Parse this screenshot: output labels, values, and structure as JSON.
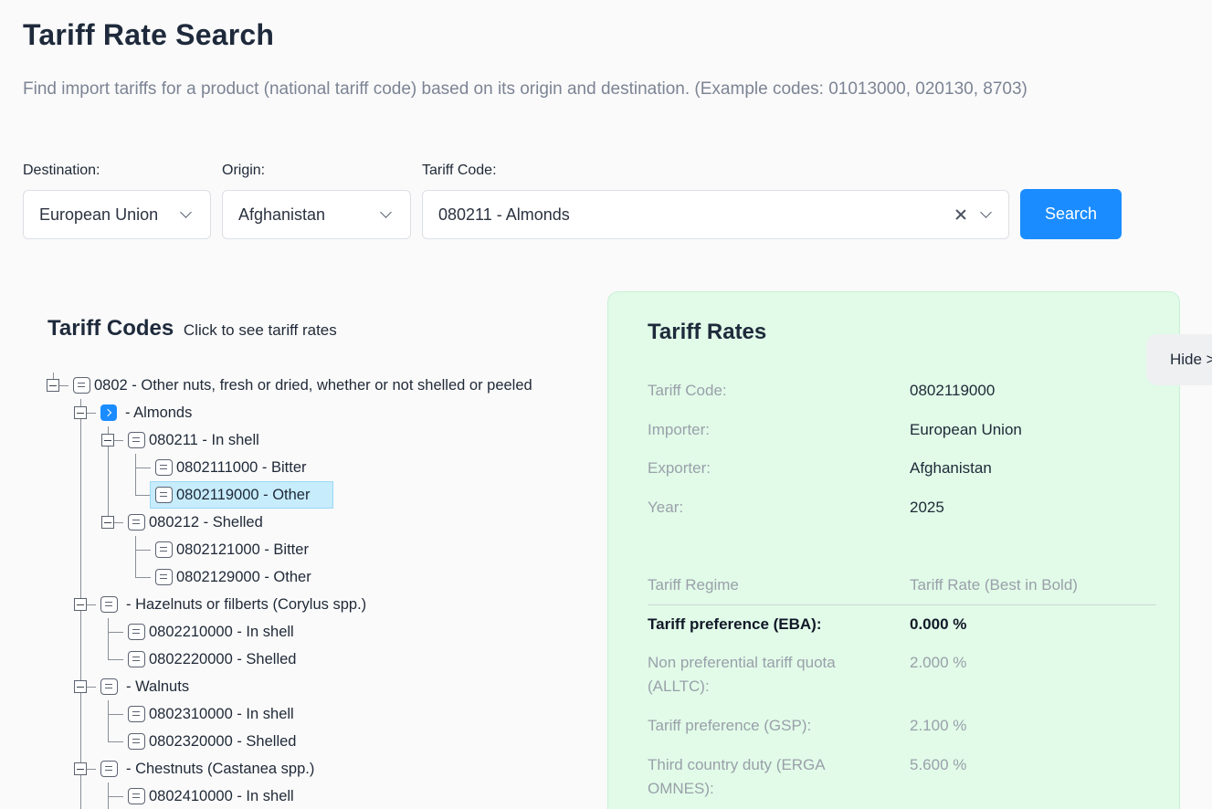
{
  "page": {
    "title": "Tariff Rate Search",
    "subtitle": "Find import tariffs for a product (national tariff code) based on its origin and destination. (Example codes: 01013000, 020130, 8703)"
  },
  "form": {
    "destination_label": "Destination:",
    "destination_value": "European Union",
    "origin_label": "Origin:",
    "origin_value": "Afghanistan",
    "code_label": "Tariff Code:",
    "code_value": "080211 - Almonds",
    "search_label": "Search"
  },
  "codes": {
    "title": "Tariff Codes",
    "hint": "Click to see tariff rates",
    "items": [
      "0802 - Other nuts, fresh or dried, whether or not shelled or peeled",
      "- Almonds",
      "080211 - In shell",
      "0802111000 - Bitter",
      "0802119000 - Other",
      "080212 - Shelled",
      "0802121000 - Bitter",
      "0802129000 - Other",
      "- Hazelnuts or filberts (Corylus spp.)",
      "0802210000 - In shell",
      "0802220000 - Shelled",
      "- Walnuts",
      "0802310000 - In shell",
      "0802320000 - Shelled",
      "- Chestnuts (Castanea spp.)",
      "0802410000 - In shell"
    ]
  },
  "rates": {
    "title": "Tariff Rates",
    "hide_label": "Hide >",
    "info": [
      {
        "label": "Tariff Code:",
        "value": "0802119000"
      },
      {
        "label": "Importer:",
        "value": "European Union"
      },
      {
        "label": "Exporter:",
        "value": "Afghanistan"
      },
      {
        "label": "Year:",
        "value": "2025"
      }
    ],
    "regime_header": "Tariff Regime",
    "rate_header": "Tariff Rate (Best in Bold)",
    "regimes": [
      {
        "label": "Tariff preference (EBA):",
        "value": "0.000 %",
        "best": true
      },
      {
        "label": "Non preferential tariff quota (ALLTC):",
        "value": "2.000 %"
      },
      {
        "label": "Tariff preference (GSP):",
        "value": "2.100 %"
      },
      {
        "label": "Third country duty (ERGA OMNES):",
        "value": "5.600 %"
      }
    ]
  },
  "colors": {
    "accent": "#1a8cff",
    "panel": "#e1fbe8",
    "selected_row": "#c7ecfc"
  }
}
